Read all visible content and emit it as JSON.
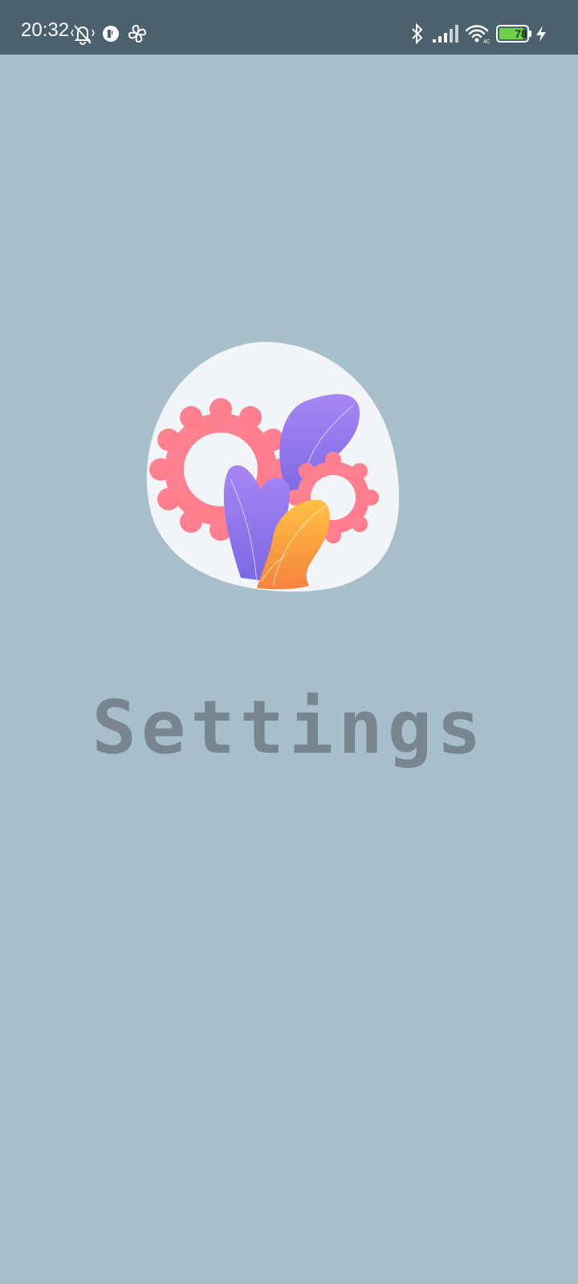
{
  "status_bar": {
    "time": "20:32",
    "battery_level": "78",
    "icons": [
      "bell-off-vibrate-icon",
      "circle-app-icon",
      "pinwheel-icon",
      "bluetooth-icon",
      "signal-icon",
      "wifi-icon",
      "battery-icon",
      "charging-bolt-icon"
    ],
    "colors": {
      "background": "#4b616d",
      "battery_fill": "#6fd14a"
    }
  },
  "screen": {
    "title": "Settings",
    "illustration": "settings-gears-plants-illustration",
    "colors": {
      "background": "#a7bfcb",
      "title": "#77868f",
      "blob": "#f2f5f8"
    }
  }
}
